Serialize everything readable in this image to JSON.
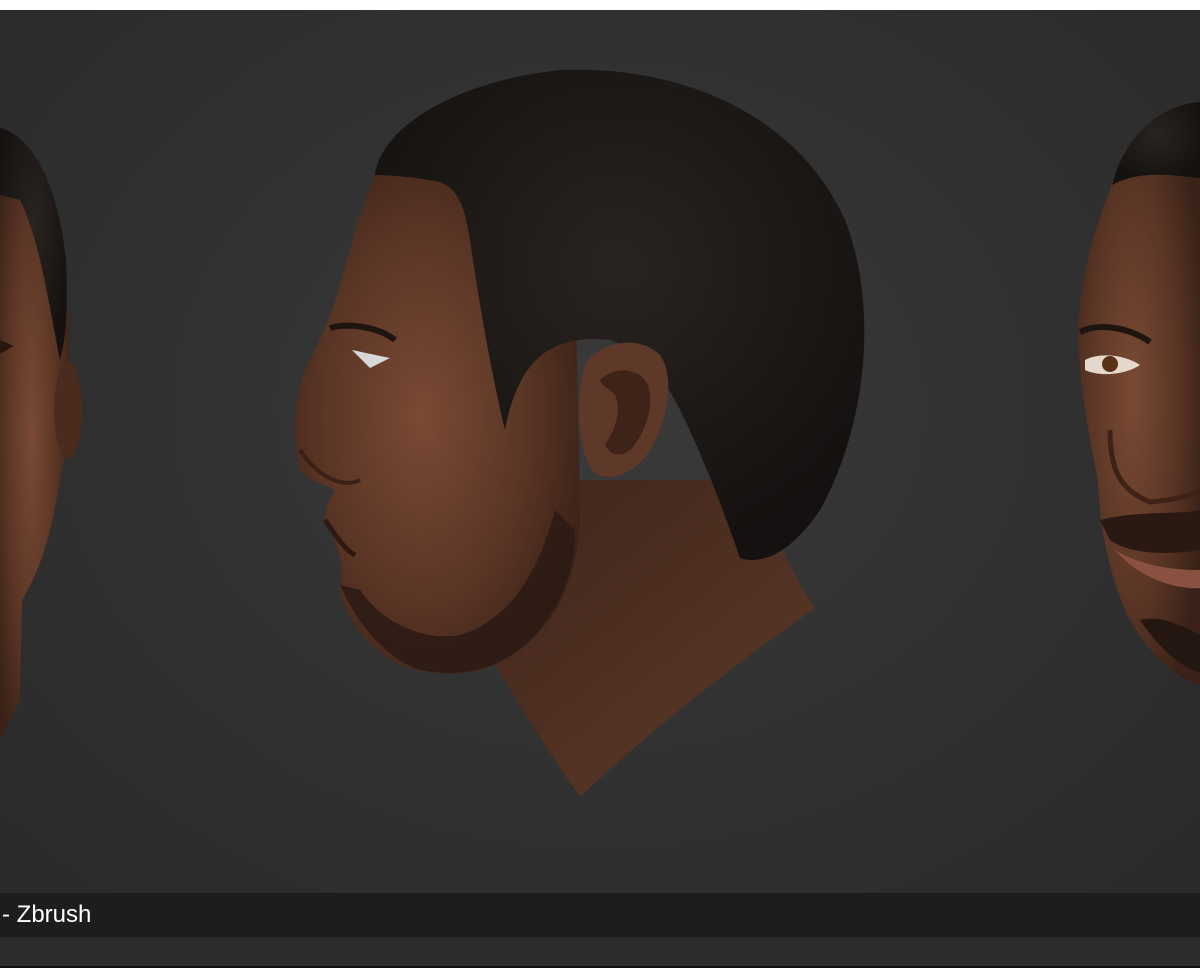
{
  "viewport": {
    "subject": "3d-head-render",
    "views": [
      "front-left-partial",
      "profile-left",
      "front-right-partial"
    ]
  },
  "caption": {
    "text": "- Zbrush"
  },
  "colors": {
    "background": "#323232",
    "caption_bar": "#1d1d1d",
    "caption_text": "#ffffff",
    "skin": "#5a3626",
    "hair": "#1c1816"
  }
}
